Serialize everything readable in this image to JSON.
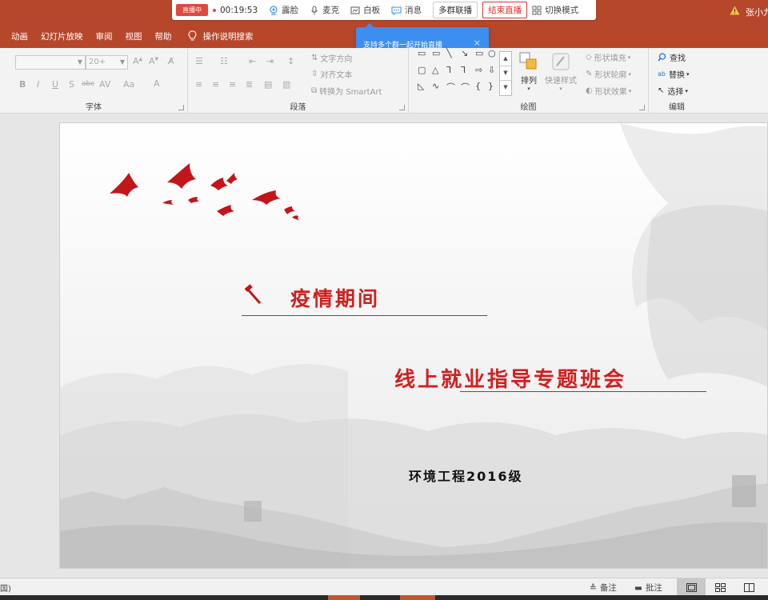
{
  "livebar": {
    "live_badge": "直播中",
    "timer": "00:19:53",
    "items": [
      "露脸",
      "麦克",
      "白板",
      "消息"
    ],
    "multi_group_button": "多群联播",
    "end_live_button": "结束直播",
    "switch_mode": "切换模式"
  },
  "user": {
    "name": "张小九"
  },
  "menu": {
    "items": [
      "动画",
      "幻灯片放映",
      "审阅",
      "视图",
      "帮助"
    ],
    "search_label": "操作说明搜索"
  },
  "tooltip": {
    "text": "支持多个群一起开始直播",
    "close": "×"
  },
  "ribbon": {
    "font_group": {
      "label": "字体",
      "font_size": "20+"
    },
    "paragraph_group": {
      "label": "段落",
      "text_direction": "文字方向",
      "align_text": "对齐文本",
      "convert_smartart": "转换为 SmartArt"
    },
    "drawing_group": {
      "label": "绘图",
      "arrange": "排列",
      "quick_styles": "快速样式",
      "shape_fill": "形状填充",
      "shape_outline": "形状轮廓",
      "shape_effects": "形状效果"
    },
    "editing_group": {
      "label": "编辑",
      "find": "查找",
      "replace": "替换",
      "select": "选择"
    }
  },
  "slide": {
    "title1": "疫情期间",
    "title2": "线上就业指导专题班会",
    "subtitle": "环境工程2016级"
  },
  "statusbar": {
    "left_text": "国)",
    "notes": "备注",
    "comments": "批注"
  },
  "colors": {
    "accent": "#b7472a",
    "title_red": "#d21f1f",
    "tooltip_blue": "#3c8ff0",
    "live_red": "#e0483e"
  }
}
